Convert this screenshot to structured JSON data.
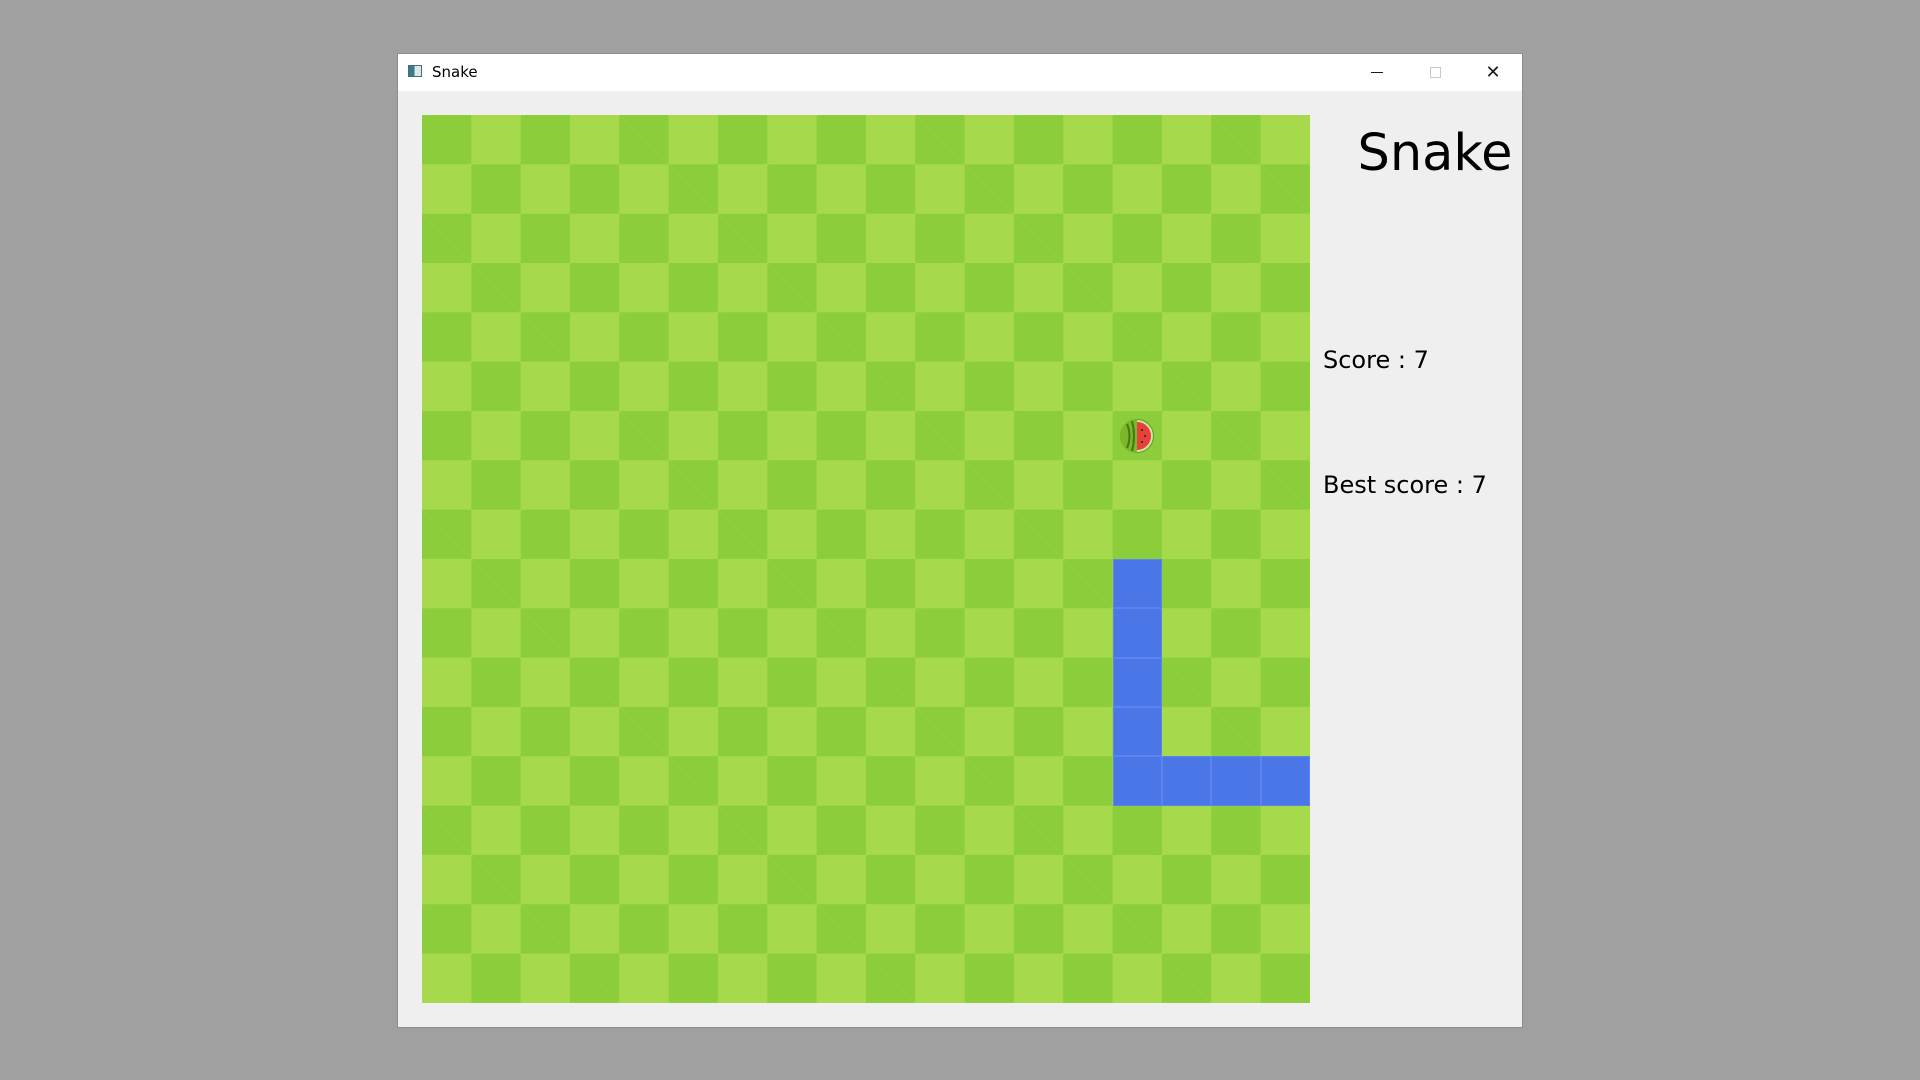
{
  "window": {
    "title": "Snake",
    "icon": "app-window-icon",
    "controls": {
      "minimize_icon": "minimize-icon",
      "maximize_icon": "maximize-icon",
      "close_icon": "close-icon",
      "close_glyph": "✕"
    }
  },
  "game": {
    "title": "Snake",
    "score_text": "Score : 7",
    "best_score_text": "Best score : 7",
    "grid": {
      "columns": 18,
      "rows": 18,
      "light_color": "#a6da4c",
      "dark_color": "#8ccd3c"
    },
    "snake": {
      "color": "#4a76e8",
      "cells": [
        {
          "col": 14,
          "row": 9
        },
        {
          "col": 14,
          "row": 10
        },
        {
          "col": 14,
          "row": 11
        },
        {
          "col": 14,
          "row": 12
        },
        {
          "col": 14,
          "row": 13
        },
        {
          "col": 15,
          "row": 13
        },
        {
          "col": 16,
          "row": 13
        },
        {
          "col": 17,
          "row": 13
        }
      ]
    },
    "fruit": {
      "type": "watermelon-icon",
      "col": 14,
      "row": 6
    }
  }
}
